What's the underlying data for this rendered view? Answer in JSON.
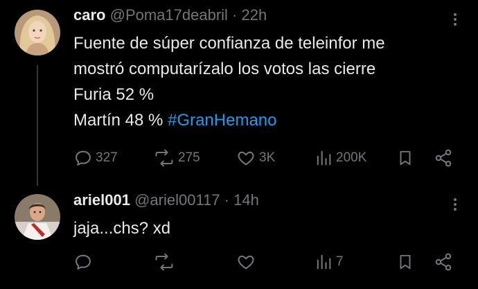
{
  "tweet1": {
    "author_name": "caro",
    "handle": "@Poma17deabril",
    "separator": "·",
    "time": "22h",
    "lines": [
      "Fuente de súper confianza de teleinfor me",
      "mostró computarízalo los votos las cierre",
      "Furia 52 %"
    ],
    "last_line_text": "Martín 48 % ",
    "hashtag": "#GranHemano",
    "replies": "327",
    "retweets": "275",
    "likes": "3K",
    "views": "200K"
  },
  "tweet2": {
    "author_name": "ariel001",
    "handle": "@ariel00117",
    "separator": "·",
    "time": "14h",
    "text": "jaja...chs? xd",
    "views": "7"
  },
  "colors": {
    "background": "#000000",
    "text": "#e7e9ea",
    "muted": "#71767b",
    "link": "#1d9bf0"
  }
}
